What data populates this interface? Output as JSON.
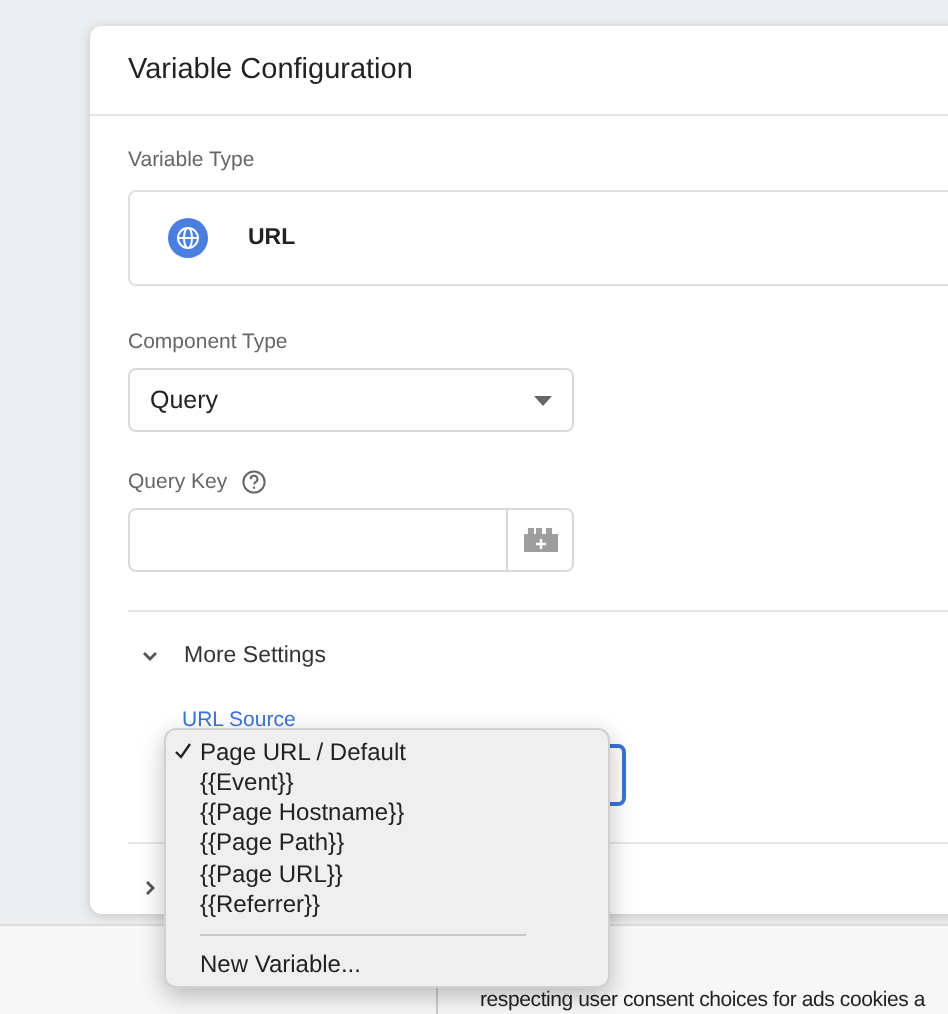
{
  "dialog": {
    "title": "Variable Configuration",
    "variable_type": {
      "label": "Variable Type",
      "value": "URL"
    },
    "component_type": {
      "label": "Component Type",
      "value": "Query"
    },
    "query_key": {
      "label": "Query Key"
    },
    "more_settings": {
      "label": "More Settings",
      "expanded": true,
      "url_source": {
        "label": "URL Source"
      }
    },
    "next_section": {
      "expanded": false
    }
  },
  "dropdown_menu": {
    "options": [
      {
        "label": "Page URL / Default",
        "selected": true
      },
      {
        "label": "{{Event}}",
        "selected": false
      },
      {
        "label": "{{Page Hostname}}",
        "selected": false
      },
      {
        "label": "{{Page Path}}",
        "selected": false
      },
      {
        "label": "{{Page URL}}",
        "selected": false
      },
      {
        "label": "{{Referrer}}",
        "selected": false
      }
    ],
    "footer_item": "New Variable..."
  },
  "background_text": "respecting user consent choices for ads cookies a"
}
